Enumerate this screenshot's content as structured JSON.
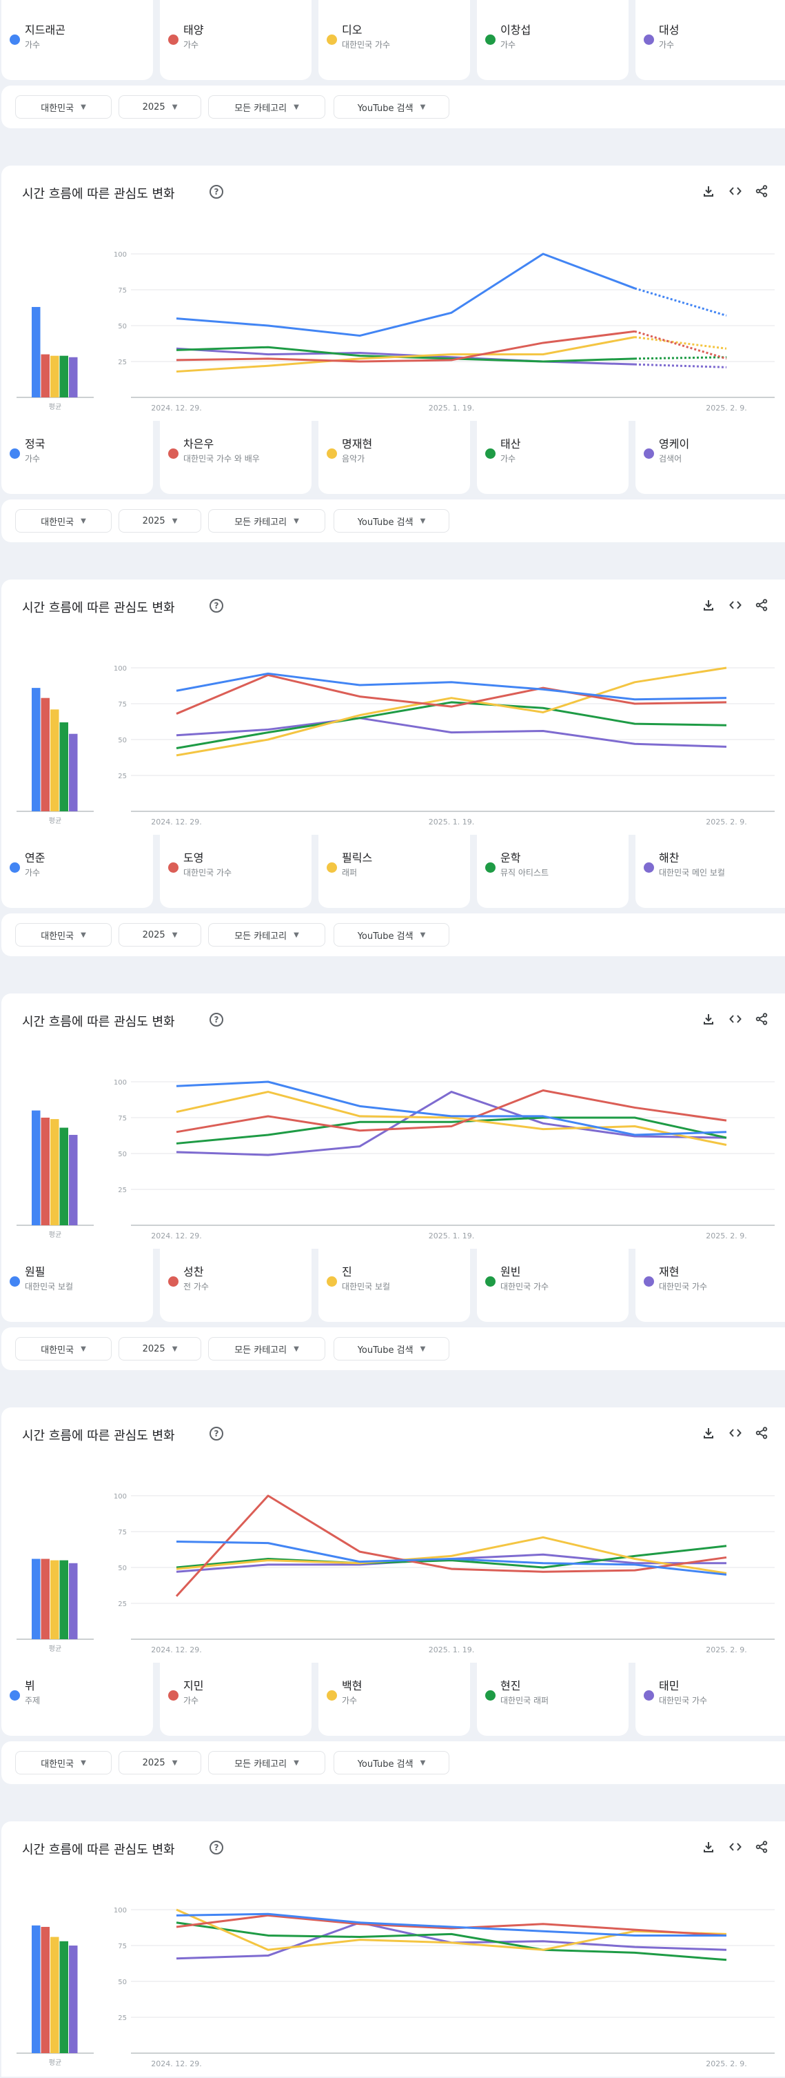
{
  "colors": {
    "series": [
      "#4285f4",
      "#db5e56",
      "#f4c542",
      "#1e9b45",
      "#7e6bd0"
    ],
    "grid": "#e4e6e9",
    "axis": "#9aa0a6"
  },
  "filters": {
    "region": "대한민국",
    "year": "2025",
    "category": "모든 카테고리",
    "search_type": "YouTube 검색",
    "caret": "▼"
  },
  "chart_header": {
    "title": "시간 흐름에 따른 관심도 변화",
    "help": "?",
    "icons": [
      "download-icon",
      "embed-code-icon",
      "share-icon"
    ]
  },
  "sections": [
    {
      "legend": [
        {
          "name": "지드래곤",
          "sub": "가수"
        },
        {
          "name": "태양",
          "sub": "가수"
        },
        {
          "name": "디오",
          "sub": "대한민국 가수"
        },
        {
          "name": "이창섭",
          "sub": "가수"
        },
        {
          "name": "대성",
          "sub": "가수"
        }
      ]
    },
    {
      "legend": [
        {
          "name": "정국",
          "sub": "가수"
        },
        {
          "name": "차은우",
          "sub": "대한민국 가수 와 배우"
        },
        {
          "name": "명재현",
          "sub": "음악가"
        },
        {
          "name": "태산",
          "sub": "가수"
        },
        {
          "name": "영케이",
          "sub": "검색어"
        }
      ]
    },
    {
      "legend": [
        {
          "name": "연준",
          "sub": "가수"
        },
        {
          "name": "도영",
          "sub": "대한민국 가수"
        },
        {
          "name": "필릭스",
          "sub": "래퍼"
        },
        {
          "name": "운학",
          "sub": "뮤직 아티스트"
        },
        {
          "name": "해찬",
          "sub": "대한민국 메인 보컬"
        }
      ]
    },
    {
      "legend": [
        {
          "name": "원필",
          "sub": "대한민국 보컬"
        },
        {
          "name": "성찬",
          "sub": "전 가수"
        },
        {
          "name": "진",
          "sub": "대한민국 보컬"
        },
        {
          "name": "원빈",
          "sub": "대한민국 가수"
        },
        {
          "name": "재현",
          "sub": "대한민국 가수"
        }
      ]
    },
    {
      "legend": [
        {
          "name": "뷔",
          "sub": "주제"
        },
        {
          "name": "지민",
          "sub": "가수"
        },
        {
          "name": "백현",
          "sub": "가수"
        },
        {
          "name": "현진",
          "sub": "대한민국 래퍼"
        },
        {
          "name": "태민",
          "sub": "대한민국 가수"
        }
      ]
    }
  ],
  "chart_data": [
    {
      "type": "line",
      "title": "시간 흐름에 따른 관심도 변화",
      "ylim": [
        0,
        100
      ],
      "yticks": [
        25,
        50,
        75,
        100
      ],
      "x_tick_labels": [
        "2024. 12. 29.",
        "2025. 1. 19.",
        "2025. 2. 9."
      ],
      "x_tick_indices": [
        0,
        3,
        6
      ],
      "avg_label": "평균",
      "partial_last_point": true,
      "series": [
        {
          "name": "지드래곤",
          "values": [
            55,
            50,
            43,
            59,
            100,
            76,
            57
          ],
          "average": 63
        },
        {
          "name": "태양",
          "values": [
            26,
            27,
            25,
            26,
            38,
            46,
            27
          ],
          "average": 30
        },
        {
          "name": "디오",
          "values": [
            18,
            22,
            27,
            30,
            30,
            42,
            34
          ],
          "average": 29
        },
        {
          "name": "이창섭",
          "values": [
            33,
            35,
            29,
            27,
            25,
            27,
            28
          ],
          "average": 29
        },
        {
          "name": "대성",
          "values": [
            34,
            30,
            31,
            28,
            25,
            23,
            21
          ],
          "average": 28
        }
      ]
    },
    {
      "type": "line",
      "title": "시간 흐름에 따른 관심도 변화",
      "ylim": [
        0,
        100
      ],
      "yticks": [
        25,
        50,
        75,
        100
      ],
      "x_tick_labels": [
        "2024. 12. 29.",
        "2025. 1. 19.",
        "2025. 2. 9."
      ],
      "x_tick_indices": [
        0,
        3,
        6
      ],
      "avg_label": "평균",
      "partial_last_point": false,
      "series": [
        {
          "name": "정국",
          "values": [
            84,
            96,
            88,
            90,
            85,
            78,
            79
          ],
          "average": 86
        },
        {
          "name": "차은우",
          "values": [
            68,
            95,
            80,
            73,
            86,
            75,
            76
          ],
          "average": 79
        },
        {
          "name": "명재현",
          "values": [
            39,
            50,
            67,
            79,
            69,
            90,
            100
          ],
          "average": 71
        },
        {
          "name": "태산",
          "values": [
            44,
            55,
            65,
            76,
            72,
            61,
            60
          ],
          "average": 62
        },
        {
          "name": "영케이",
          "values": [
            53,
            57,
            65,
            55,
            56,
            47,
            45
          ],
          "average": 54
        }
      ]
    },
    {
      "type": "line",
      "title": "시간 흐름에 따른 관심도 변화",
      "ylim": [
        0,
        100
      ],
      "yticks": [
        25,
        50,
        75,
        100
      ],
      "x_tick_labels": [
        "2024. 12. 29.",
        "2025. 1. 19.",
        "2025. 2. 9."
      ],
      "x_tick_indices": [
        0,
        3,
        6
      ],
      "avg_label": "평균",
      "partial_last_point": false,
      "series": [
        {
          "name": "연준",
          "values": [
            97,
            100,
            83,
            76,
            76,
            63,
            65
          ],
          "average": 80
        },
        {
          "name": "도영",
          "values": [
            65,
            76,
            66,
            69,
            94,
            82,
            73
          ],
          "average": 75
        },
        {
          "name": "필릭스",
          "values": [
            79,
            93,
            76,
            75,
            67,
            69,
            56
          ],
          "average": 74
        },
        {
          "name": "운학",
          "values": [
            57,
            63,
            72,
            72,
            75,
            75,
            61
          ],
          "average": 68
        },
        {
          "name": "해찬",
          "values": [
            51,
            49,
            55,
            93,
            71,
            62,
            61
          ],
          "average": 63
        }
      ]
    },
    {
      "type": "line",
      "title": "시간 흐름에 따른 관심도 변화",
      "ylim": [
        0,
        100
      ],
      "yticks": [
        25,
        50,
        75,
        100
      ],
      "x_tick_labels": [
        "2024. 12. 29.",
        "2025. 1. 19.",
        "2025. 2. 9."
      ],
      "x_tick_indices": [
        0,
        3,
        6
      ],
      "avg_label": "평균",
      "partial_last_point": false,
      "series": [
        {
          "name": "원필",
          "values": [
            68,
            67,
            54,
            56,
            53,
            52,
            45
          ],
          "average": 56
        },
        {
          "name": "성찬",
          "values": [
            30,
            100,
            61,
            49,
            47,
            48,
            57
          ],
          "average": 56
        },
        {
          "name": "진",
          "values": [
            49,
            55,
            53,
            58,
            71,
            56,
            46
          ],
          "average": 55
        },
        {
          "name": "원빈",
          "values": [
            50,
            56,
            53,
            55,
            50,
            58,
            65
          ],
          "average": 55
        },
        {
          "name": "재현",
          "values": [
            47,
            52,
            52,
            56,
            59,
            53,
            53
          ],
          "average": 53
        }
      ]
    },
    {
      "type": "line",
      "title": "시간 흐름에 따른 관심도 변화",
      "ylim": [
        0,
        100
      ],
      "yticks": [
        25,
        50,
        75,
        100
      ],
      "x_tick_labels": [
        "2024. 12. 29.",
        "",
        "2025. 2. 9."
      ],
      "x_tick_indices": [
        0,
        3,
        6
      ],
      "avg_label": "평균",
      "partial_last_point": false,
      "series": [
        {
          "name": "뷔",
          "values": [
            96,
            97,
            91,
            88,
            85,
            82,
            82
          ],
          "average": 89
        },
        {
          "name": "지민",
          "values": [
            88,
            96,
            90,
            87,
            90,
            86,
            82
          ],
          "average": 88
        },
        {
          "name": "백현",
          "values": [
            100,
            72,
            79,
            77,
            72,
            85,
            83
          ],
          "average": 81
        },
        {
          "name": "현진",
          "values": [
            91,
            82,
            81,
            83,
            72,
            70,
            65
          ],
          "average": 78
        },
        {
          "name": "태민",
          "values": [
            66,
            68,
            91,
            77,
            78,
            74,
            72
          ],
          "average": 75
        }
      ]
    }
  ]
}
